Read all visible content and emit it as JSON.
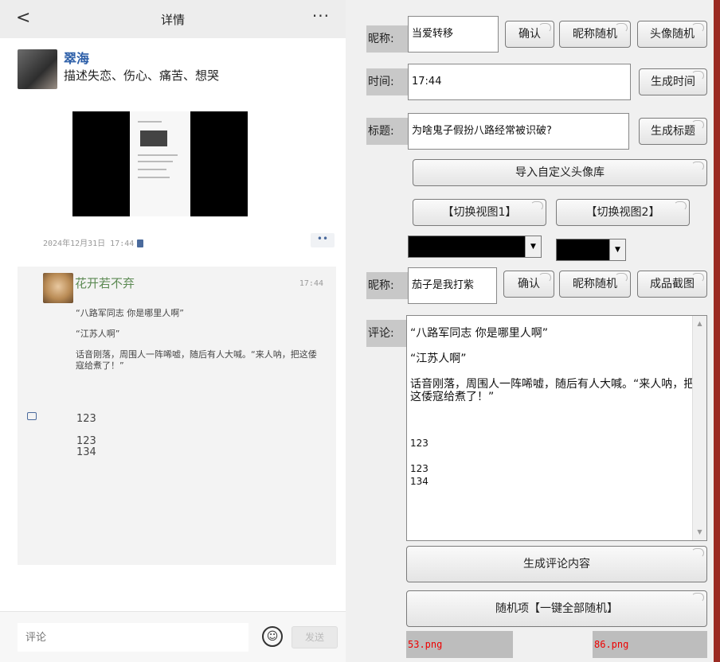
{
  "phone": {
    "topbar": {
      "back": "<",
      "title": "详情",
      "more": "···"
    },
    "post": {
      "name": "翠海",
      "text": "描述失恋、伤心、痛苦、想哭",
      "date": "2024年12月31日  17:44"
    },
    "comment": {
      "name": "花开若不弃",
      "time": "17:44",
      "lines": [
        "“八路军同志 你是哪里人啊”",
        "“江苏人啊”",
        "话音刚落，周围人一阵唏嘘，随后有人大喊。“来人呐，把这倭寇给煮了！”"
      ]
    },
    "replies": [
      "123",
      "123\n134"
    ],
    "footer": {
      "placeholder": "评论",
      "send": "发送"
    }
  },
  "panel": {
    "nickname_label": "昵称:",
    "nickname_value": "当爱转移",
    "confirm": "确认",
    "random_nick": "昵称随机",
    "random_avatar": "头像随机",
    "time_label": "时间:",
    "time_value": "17:44",
    "gen_time": "生成时间",
    "title_label": "标题:",
    "title_value": "为啥鬼子假扮八路经常被识破?",
    "gen_title": "生成标题",
    "import_avatar": "导入自定义头像库",
    "view1": "【切换视图1】",
    "view2": "【切换视图2】",
    "nickname2_label": "昵称:",
    "nickname2_value": "茄子是我打紫",
    "confirm2": "确认",
    "random_nick2": "昵称随机",
    "screenshot": "成品截图",
    "comment_label": "评论:",
    "comment_lines": [
      "“八路军同志  你是哪里人啊”",
      "“江苏人啊”",
      "话音刚落，周围人一阵唏嘘，随后有人大喊。“来人呐，把这倭寇给煮了！”",
      "123",
      "123\n134"
    ],
    "gen_comment": "生成评论内容",
    "random_all": "随机项【一键全部随机】",
    "file1": "53.png",
    "file2": "86.png"
  }
}
